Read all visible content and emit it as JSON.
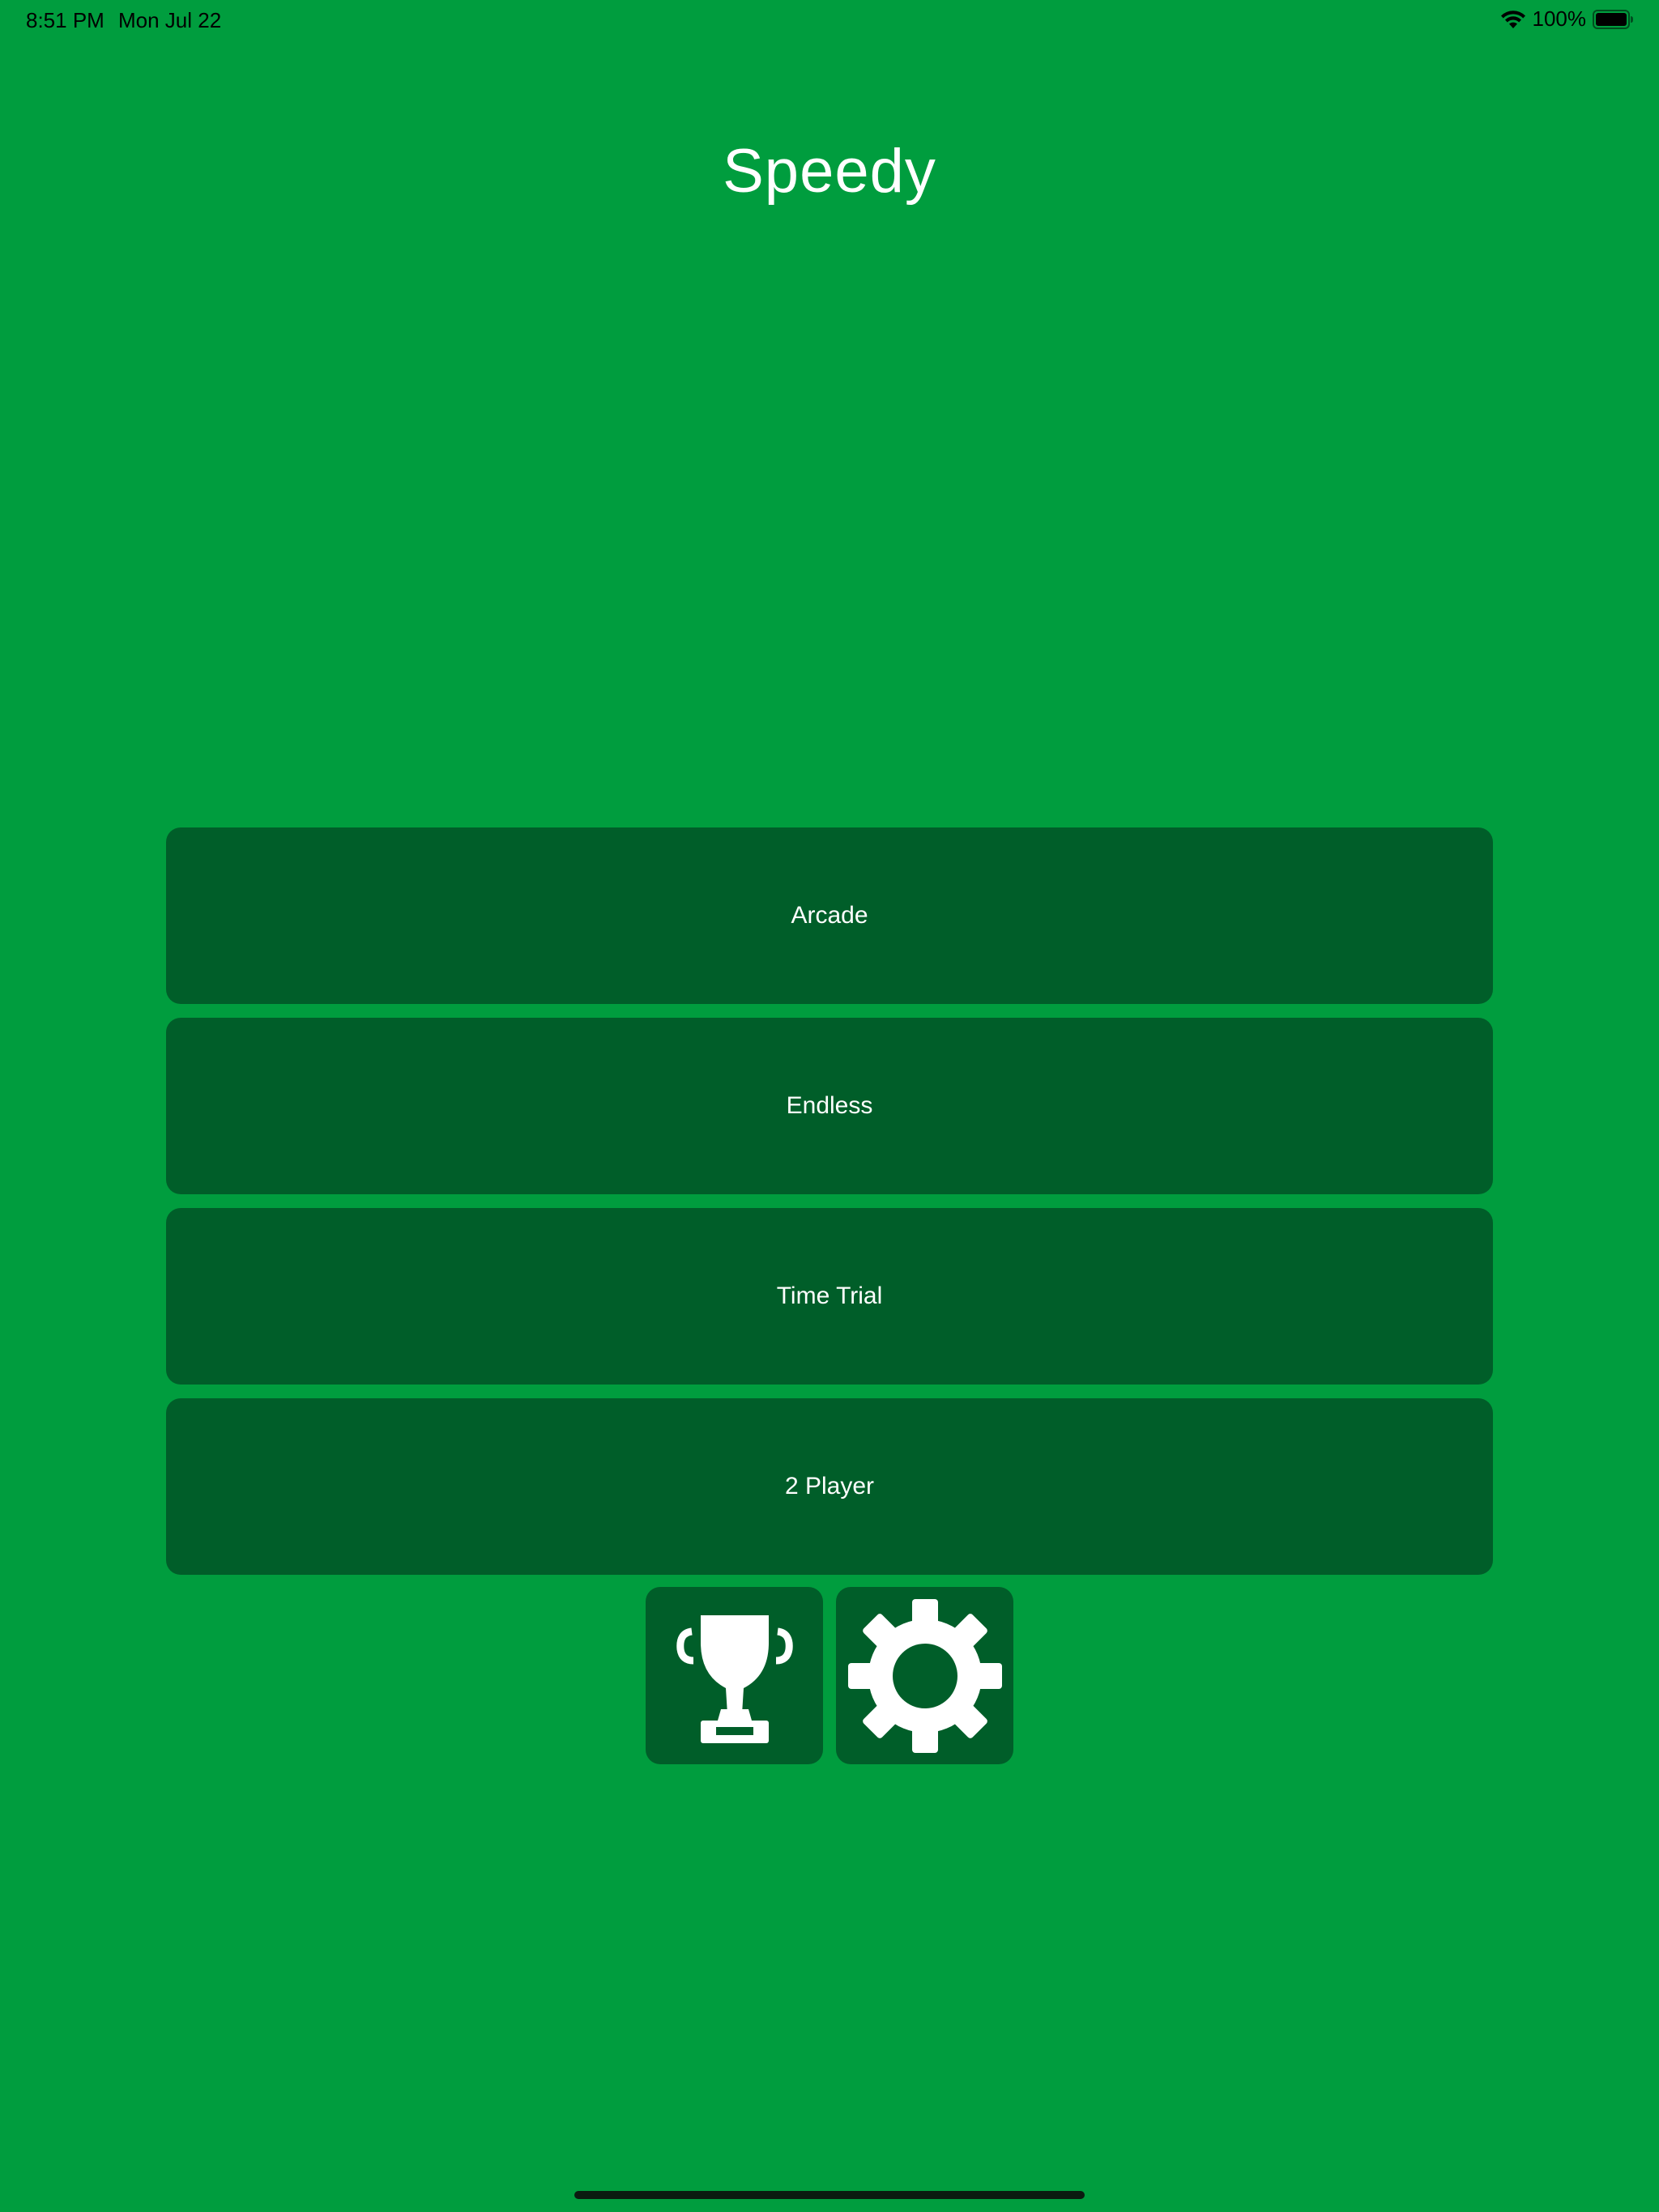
{
  "status_bar": {
    "time": "8:51 PM",
    "date": "Mon Jul 22",
    "battery_percent": "100%",
    "icons": [
      "wifi-icon",
      "battery-icon"
    ]
  },
  "app": {
    "title": "Speedy"
  },
  "menu": {
    "items": [
      {
        "label": "Arcade"
      },
      {
        "label": "Endless"
      },
      {
        "label": "Time Trial"
      },
      {
        "label": "2 Player"
      }
    ]
  },
  "icon_buttons": [
    {
      "icon": "trophy-icon"
    },
    {
      "icon": "gear-icon"
    }
  ],
  "colors": {
    "background": "#009d3e",
    "button": "#005e29",
    "text": "#ffffff"
  }
}
